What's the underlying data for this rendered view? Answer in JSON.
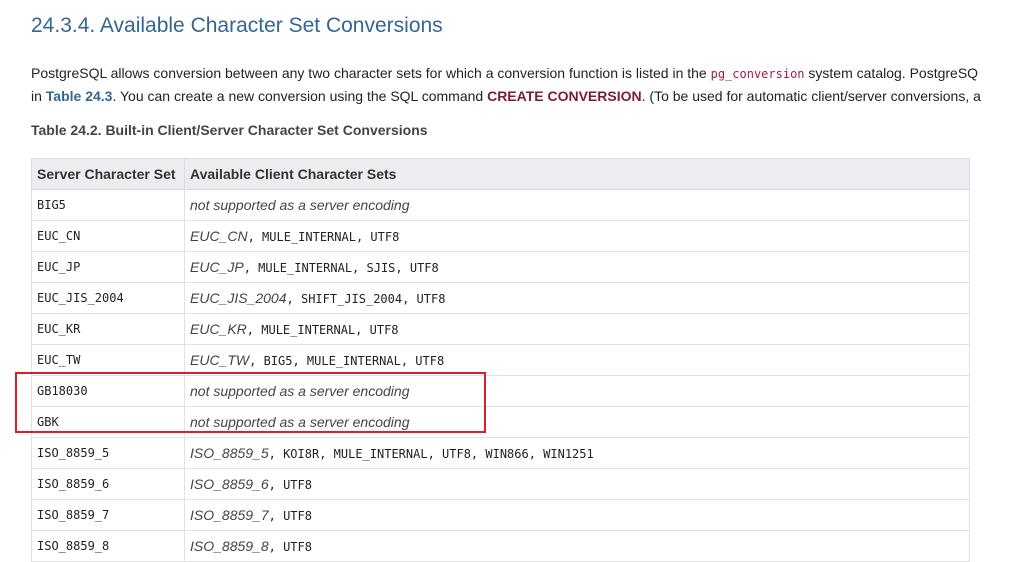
{
  "heading": "24.3.4. Available Character Set Conversions",
  "intro": {
    "line1_pre": "PostgreSQL allows conversion between any two character sets for which a conversion function is listed in the ",
    "line1_code": "pg_conversion",
    "line1_post": " system catalog. PostgreSQ",
    "line2_pre": "in ",
    "line2_link": "Table 24.3",
    "line2_mid": ". You can create a new conversion using the SQL command ",
    "line2_cmd": "CREATE CONVERSION",
    "line2_post": ". (To be used for automatic client/server conversions, a"
  },
  "table": {
    "caption": "Table 24.2. Built-in Client/Server Character Set Conversions",
    "headers": [
      "Server Character Set",
      "Available Client Character Sets"
    ],
    "rows": [
      {
        "server": "BIG5",
        "emph": "not supported as a server encoding",
        "rest": ""
      },
      {
        "server": "EUC_CN",
        "emph": "EUC_CN",
        "rest": ", MULE_INTERNAL, UTF8"
      },
      {
        "server": "EUC_JP",
        "emph": "EUC_JP",
        "rest": ", MULE_INTERNAL, SJIS, UTF8"
      },
      {
        "server": "EUC_JIS_2004",
        "emph": "EUC_JIS_2004",
        "rest": ", SHIFT_JIS_2004, UTF8"
      },
      {
        "server": "EUC_KR",
        "emph": "EUC_KR",
        "rest": ", MULE_INTERNAL, UTF8"
      },
      {
        "server": "EUC_TW",
        "emph": "EUC_TW",
        "rest": ", BIG5, MULE_INTERNAL, UTF8"
      },
      {
        "server": "GB18030",
        "emph": "not supported as a server encoding",
        "rest": ""
      },
      {
        "server": "GBK",
        "emph": "not supported as a server encoding",
        "rest": ""
      },
      {
        "server": "ISO_8859_5",
        "emph": "ISO_8859_5",
        "rest": ", KOI8R, MULE_INTERNAL, UTF8, WIN866, WIN1251"
      },
      {
        "server": "ISO_8859_6",
        "emph": "ISO_8859_6",
        "rest": ", UTF8"
      },
      {
        "server": "ISO_8859_7",
        "emph": "ISO_8859_7",
        "rest": ", UTF8"
      },
      {
        "server": "ISO_8859_8",
        "emph": "ISO_8859_8",
        "rest": ", UTF8"
      }
    ]
  },
  "annotation_color": "#d6202a"
}
